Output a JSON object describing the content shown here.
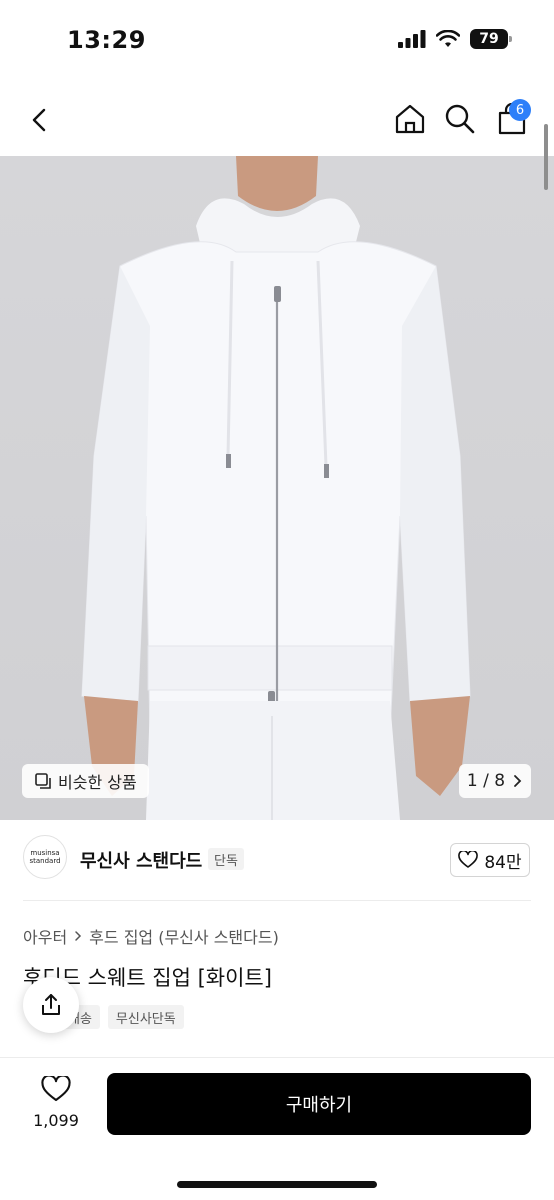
{
  "status_bar": {
    "time": "13:29",
    "battery": "79"
  },
  "nav": {
    "cart_badge": "6"
  },
  "gallery": {
    "similar_label": "비슷한 상품",
    "pager": "1 / 8"
  },
  "brand": {
    "logo_line1": "musinsa",
    "logo_line2": "standard",
    "name": "무신사 스탠다드",
    "tag": "단독",
    "likes": "84만"
  },
  "product": {
    "breadcrumb": [
      "아우터",
      "후드 집업 (무신사 스탠다드)"
    ],
    "title": "후디드 스웨트 집업 [화이트]",
    "tags": [
      "배송",
      "무신사단독"
    ]
  },
  "bottom": {
    "wish_count": "1,099",
    "buy_label": "구매하기"
  },
  "colors": {
    "accent_badge": "#2d7ff9",
    "buy_button": "#000000"
  }
}
